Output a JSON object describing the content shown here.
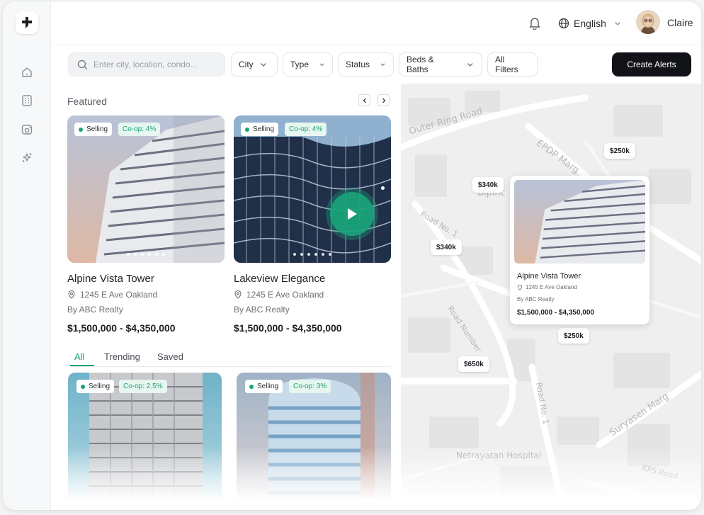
{
  "header": {
    "language": "English",
    "user_name": "Claire"
  },
  "search": {
    "placeholder": "Enter city, location, condo..."
  },
  "filters": [
    "City",
    "Type",
    "Status",
    "Beds & Baths",
    "All Filters"
  ],
  "create_alerts_label": "Create Alerts",
  "featured": {
    "title": "Featured",
    "cards": [
      {
        "title": "Alpine Vista Tower",
        "address": "1245 E Ave Oakland",
        "by": "By ABC Realty",
        "price": "$1,500,000 - $4,350,000",
        "status": "Selling",
        "coop": "Co-op: 4%"
      },
      {
        "title": "Lakeview Elegance",
        "address": "1245 E Ave Oakland",
        "by": "By ABC Realty",
        "price": "$1,500,000 - $4,350,000",
        "status": "Selling",
        "coop": "Co-op: 4%"
      }
    ]
  },
  "tabs": [
    "All",
    "Trending",
    "Saved"
  ],
  "listings": [
    {
      "status": "Selling",
      "coop": "Co-op: 2.5%"
    },
    {
      "status": "Selling",
      "coop": "Co-op: 3%"
    }
  ],
  "map": {
    "labels": [
      "Outer Ring Road",
      "EPDP Marg",
      "Bipinc",
      "Road No. 1",
      "Road Number",
      "Road No. 1",
      "Suryasen Marg",
      "Netrayatan Hospital",
      "KPS Road"
    ],
    "pins": [
      "$250k",
      "$340k",
      "$340k",
      "$250k",
      "$650k"
    ],
    "popup": {
      "title": "Alpine Vista Tower",
      "address": "1245 E Ave Oakland",
      "by": "By ABC Realty",
      "price": "$1,500,000 - $4,350,000"
    }
  },
  "colors": {
    "accent": "#1aa37a",
    "dark": "#111318"
  }
}
